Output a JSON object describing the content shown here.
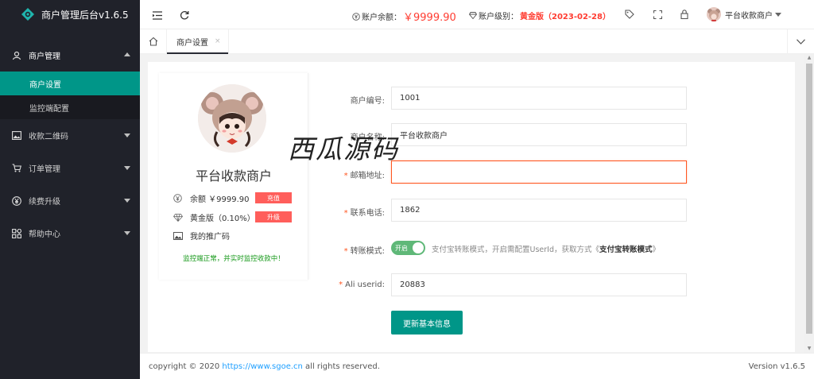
{
  "app": {
    "title": "商户管理后台v1.6.5"
  },
  "sidebar": {
    "menu": [
      {
        "label": "商户管理",
        "icon": "merchant-icon",
        "expanded": true,
        "children": [
          {
            "label": "商户设置",
            "active": true
          },
          {
            "label": "监控端配置",
            "active": false
          }
        ]
      },
      {
        "label": "收款二维码",
        "icon": "image-icon"
      },
      {
        "label": "订单管理",
        "icon": "cart-icon"
      },
      {
        "label": "续费升级",
        "icon": "yen-icon"
      },
      {
        "label": "帮助中心",
        "icon": "apps-icon"
      }
    ]
  },
  "header": {
    "balance_label": "账户余额：",
    "balance_value": "￥9999.90",
    "level_label": "账户级别：",
    "level_value": "黄金版（2023-02-28）",
    "username": "平台收款商户"
  },
  "tabs": {
    "active_label": "商户设置",
    "close_symbol": "×"
  },
  "profile": {
    "name": "平台收款商户",
    "balance_text": "余额 ￥9999.90",
    "recharge_label": "充值",
    "plan_text": "黄金版（0.10%）",
    "upgrade_label": "升级",
    "promo_text": "我的推广码",
    "monitor_status": "监控端正常，并实时监控收款中！"
  },
  "form": {
    "merchant_id_label": "商户编号:",
    "merchant_id_value": "1001",
    "merchant_name_label": "商户名称:",
    "merchant_name_value": "平台收款商户",
    "email_label": "邮箱地址:",
    "email_value": "",
    "phone_label": "联系电话:",
    "phone_value": "1862",
    "transfer_label": "转账模式:",
    "transfer_switch_text": "开启",
    "transfer_switch_on": true,
    "transfer_hint": "支付宝转账模式，开启需配置UserId，获取方式《",
    "transfer_hint_bold": "支付宝转账模式",
    "transfer_hint_end": "》",
    "ali_label": "Ali userid:",
    "ali_value": "20883",
    "submit_label": "更新基本信息",
    "required_mark": "*"
  },
  "watermark": "西瓜源码",
  "footer": {
    "copyright_prefix": "copyright © 2020 ",
    "link": "https://www.sgoe.cn",
    "copyright_suffix": " all rights reserved.",
    "version": "Version v1.6.5"
  },
  "colors": {
    "sidebar_bg": "#20222a",
    "accent": "#009688",
    "danger": "#ff5e5b",
    "success": "#5fb878"
  }
}
